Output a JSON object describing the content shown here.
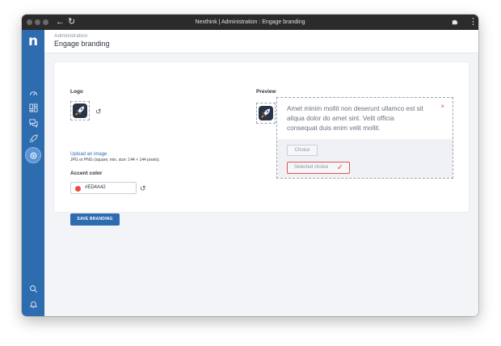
{
  "window": {
    "title": "Nexthink | Administration : Engage branding",
    "back_icon": "arrow-left-icon",
    "reload_icon": "reload-icon",
    "extension_icon": "puzzle-icon",
    "menu_icon": "more-vertical-icon"
  },
  "sidebar": {
    "logo": "n",
    "brand_color": "#2E6CB0",
    "items": [
      {
        "icon": "dashboard-gauge-icon",
        "active": false
      },
      {
        "icon": "grid-layout-icon",
        "active": false
      },
      {
        "icon": "chat-bubbles-icon",
        "active": false
      },
      {
        "icon": "rocket-icon",
        "active": false
      },
      {
        "icon": "settings-gear-icon",
        "active": true
      }
    ],
    "bottom_items": [
      {
        "icon": "search-icon"
      },
      {
        "icon": "bell-icon"
      },
      {
        "icon": "user-icon"
      }
    ]
  },
  "header": {
    "breadcrumb": "Administration",
    "title": "Engage branding"
  },
  "form": {
    "logo_label": "Logo",
    "upload_link": "Upload an image",
    "upload_hint": "JPG or PNG (square; min. size: 144 × 144 pixels).",
    "accent_label": "Accent color",
    "accent_value": "#ED4A42",
    "accent_color": "#ED4A42",
    "save_label": "SAVE BRANDING"
  },
  "preview": {
    "label": "Preview",
    "message": "Amet minim mollit non deserunt ullamco est sit aliqua dolor do amet sint. Velit officia consequat duis enim velit mollit.",
    "close": "×",
    "choice_label": "Choice",
    "selected_label": "Selected choice",
    "check": "✓"
  }
}
